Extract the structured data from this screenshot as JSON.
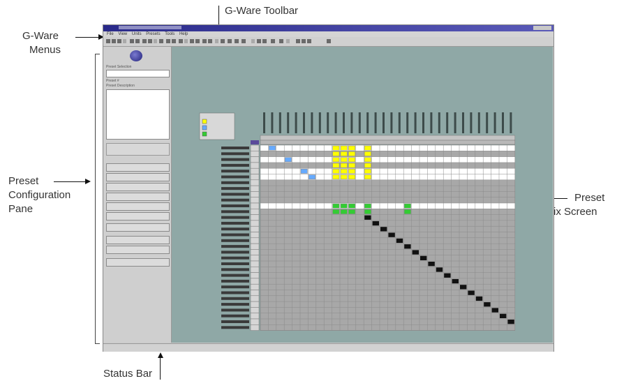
{
  "callouts": {
    "toolbar": "G-Ware Toolbar",
    "menus_line1": "G-Ware",
    "menus_line2": "Menus",
    "pane_line1": "Preset",
    "pane_line2": "Configuration",
    "pane_line3": "Pane",
    "matrix_line1": "Preset",
    "matrix_line2": "Matrix Screen",
    "status": "Status Bar"
  },
  "window": {
    "title": "",
    "menus": [
      "File",
      "View",
      "Units",
      "Presets",
      "Tools",
      "Help"
    ]
  },
  "pane": {
    "labels": [
      "Preset Selection",
      "Preset #",
      "Preset Description"
    ],
    "buttons": [
      "",
      "",
      "",
      "",
      "",
      "",
      "",
      "",
      "",
      ""
    ]
  },
  "matrix": {
    "legend": [
      "",
      "",
      ""
    ],
    "input_rows": 12,
    "output_rows": 20,
    "columns": 32,
    "colors": {
      "background": "#8fa8a6",
      "grid": "#a8a8a8",
      "row_highlight": "#ffffff",
      "yellow": "#ffff00",
      "green": "#33cc33",
      "blue": "#66aaff",
      "diagonal": "#111111"
    }
  },
  "status": {
    "fields": [
      "",
      "",
      "",
      "",
      "",
      "",
      ""
    ]
  },
  "icons": [
    "search-icon",
    "save-icon",
    "cut-icon",
    "copy-icon",
    "paste-icon",
    "grid-icon",
    "route-icon"
  ]
}
